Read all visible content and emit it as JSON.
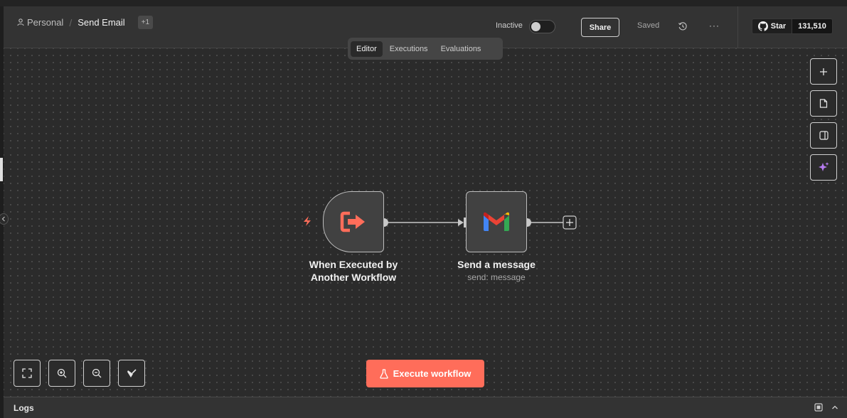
{
  "header": {
    "project": "Personal",
    "separator": "/",
    "workflow_name": "Send Email",
    "tag_count": "+1",
    "status_label": "Inactive",
    "share_label": "Share",
    "saved_label": "Saved",
    "more_label": "···",
    "github": {
      "star_label": "Star",
      "star_count": "131,510"
    }
  },
  "tabs": [
    {
      "label": "Editor",
      "active": true
    },
    {
      "label": "Executions",
      "active": false
    },
    {
      "label": "Evaluations",
      "active": false
    }
  ],
  "nodes": [
    {
      "title_line1": "When Executed by",
      "title_line2": "Another Workflow",
      "icon": "sign-in-arrow-icon"
    },
    {
      "title": "Send a message",
      "subtitle": "send: message",
      "icon": "gmail-icon"
    }
  ],
  "canvas_tools": [
    "plus-icon",
    "sticky-note-icon",
    "panel-icon",
    "ai-sparkle-icon"
  ],
  "zoom_tools": [
    "fit-view-icon",
    "zoom-in-icon",
    "zoom-out-icon",
    "tidy-up-icon"
  ],
  "execute_label": "Execute workflow",
  "logs_label": "Logs",
  "colors": {
    "accent": "#ff6d5a",
    "canvas": "#2b2b2b",
    "header": "#333333",
    "ai": "#b77cf0"
  }
}
